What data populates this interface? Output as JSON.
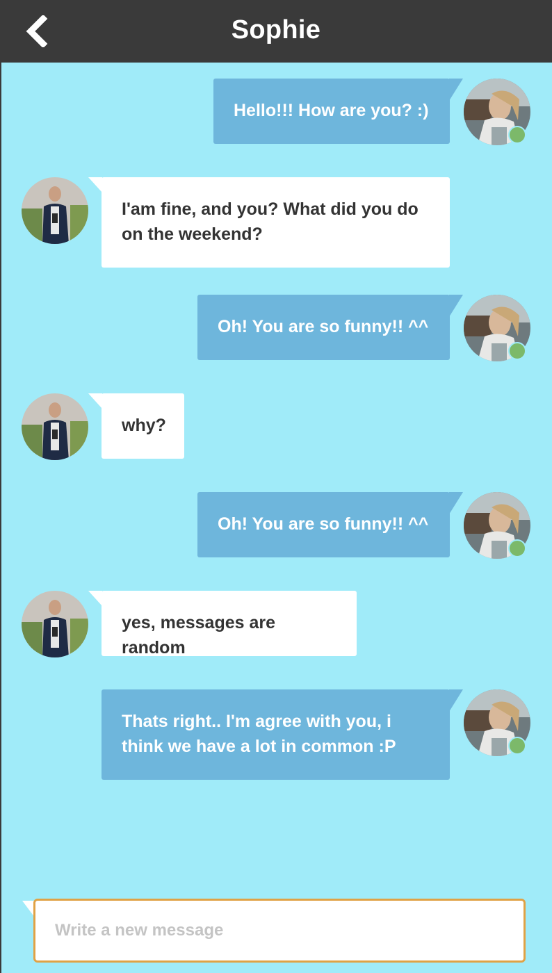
{
  "header": {
    "title": "Sophie",
    "back_icon": "chevron-left-icon"
  },
  "colors": {
    "background": "#a0ebf9",
    "header": "#3a3a3a",
    "my_bubble": "#6eb6dc",
    "their_bubble": "#ffffff",
    "online": "#7cb96a",
    "composer_border": "#e0a246"
  },
  "messages": [
    {
      "sender": "me",
      "text": "Hello!!! How are you? :)"
    },
    {
      "sender": "them",
      "text": "I'am fine, and you? What did you do on the weekend?"
    },
    {
      "sender": "me",
      "text": "Oh! You are so funny!! ^^"
    },
    {
      "sender": "them",
      "text": "why?"
    },
    {
      "sender": "me",
      "text": "Oh! You are so funny!! ^^"
    },
    {
      "sender": "them",
      "text": "yes, messages are random"
    },
    {
      "sender": "me",
      "text": "Thats right.. I'm agree with you, i think we have a lot in common :P"
    }
  ],
  "composer": {
    "placeholder": "Write a new message",
    "value": ""
  }
}
